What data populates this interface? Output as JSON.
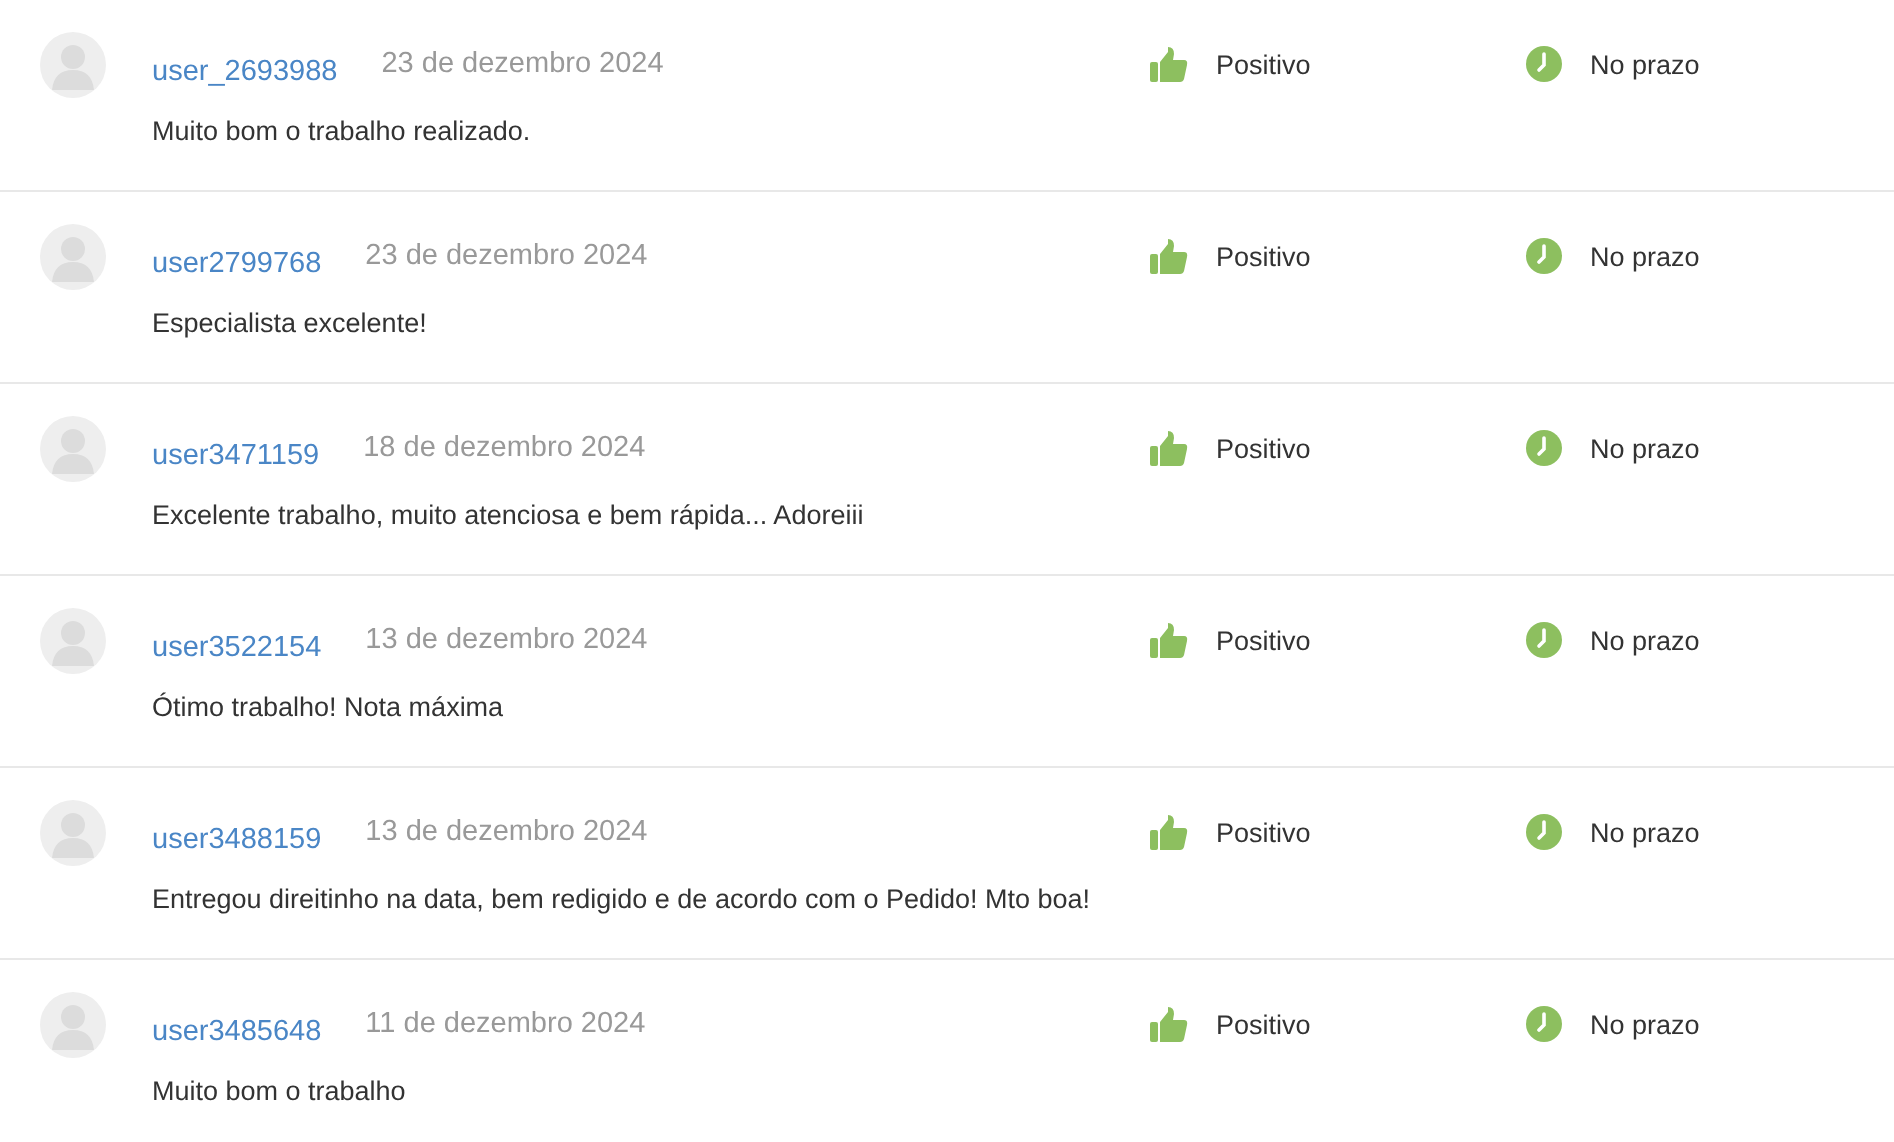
{
  "reviews": [
    {
      "user": "user_2693988",
      "date": "23 de dezembro 2024",
      "comment": "Muito bom o trabalho realizado.",
      "rating": {
        "kind": "positive",
        "label": "Positivo"
      },
      "deadline": {
        "kind": "on_time",
        "label": "No prazo"
      }
    },
    {
      "user": "user2799768",
      "date": "23 de dezembro 2024",
      "comment": "Especialista excelente!",
      "rating": {
        "kind": "positive",
        "label": "Positivo"
      },
      "deadline": {
        "kind": "on_time",
        "label": "No prazo"
      }
    },
    {
      "user": "user3471159",
      "date": "18 de dezembro 2024",
      "comment": "Excelente trabalho, muito atenciosa e bem rápida... Adoreiii",
      "rating": {
        "kind": "positive",
        "label": "Positivo"
      },
      "deadline": {
        "kind": "on_time",
        "label": "No prazo"
      }
    },
    {
      "user": "user3522154",
      "date": "13 de dezembro 2024",
      "comment": "Ótimo trabalho! Nota máxima",
      "rating": {
        "kind": "positive",
        "label": "Positivo"
      },
      "deadline": {
        "kind": "on_time",
        "label": "No prazo"
      }
    },
    {
      "user": "user3488159",
      "date": "13 de dezembro 2024",
      "comment": "Entregou direitinho na data, bem redigido e de acordo com o Pedido! Mto boa!",
      "rating": {
        "kind": "positive",
        "label": "Positivo"
      },
      "deadline": {
        "kind": "on_time",
        "label": "No prazo"
      }
    },
    {
      "user": "user3485648",
      "date": "11 de dezembro 2024",
      "comment": "Muito bom o trabalho",
      "rating": {
        "kind": "positive",
        "label": "Positivo"
      },
      "deadline": {
        "kind": "on_time",
        "label": "No prazo"
      }
    }
  ]
}
